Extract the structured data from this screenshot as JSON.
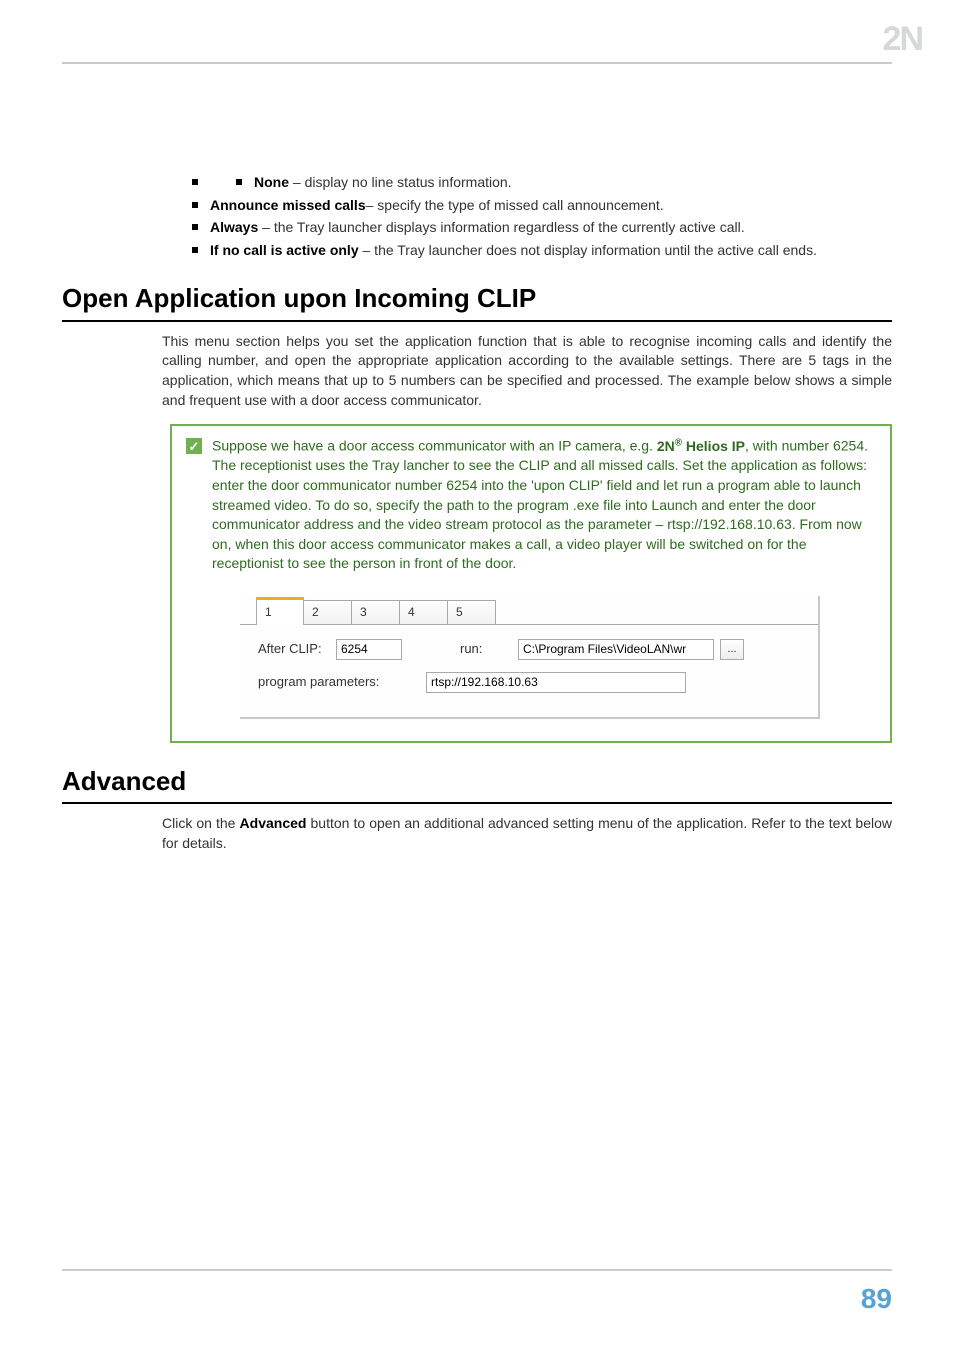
{
  "logo": "2N",
  "bullets": {
    "none": {
      "term": "None",
      "desc": " – display no line status information."
    },
    "announce": {
      "term": "Announce missed calls",
      "desc": "– specify the type of missed call announcement."
    },
    "always": {
      "term": "Always",
      "desc": " – the Tray launcher displays information regardless of the currently active call."
    },
    "ifno": {
      "term": "If no call is active only",
      "desc": " – the Tray launcher does not display information until the active call ends."
    }
  },
  "s1": {
    "heading": "Open Application upon Incoming CLIP",
    "para": "This menu section helps you set the application function that is able to recognise incoming calls and identify the calling number, and open the appropriate application according to the available settings. There are 5 tags in the application, which means that up to 5 numbers can be specified and processed. The example below shows a simple and frequent use with a door access communicator."
  },
  "note": {
    "lead": "Suppose we have a door access communicator with an IP camera, e.g. ",
    "brand": "2N",
    "reg": "®",
    "brand2": " Helios IP",
    "rest": ", with number 6254. The receptionist uses the Tray lancher to see the CLIP and all missed calls. Set the application as follows: enter the door communicator number 6254 into the 'upon CLIP' field and let run a program able to launch streamed video. To do so, specify the path to the program .exe file into Launch and enter the door communicator address and the video stream protocol as the parameter – rtsp://192.168.10.63. From now on, when this door access communicator makes a call, a video player will be switched on for the receptionist to see the person in front of the door."
  },
  "panel": {
    "tabs": [
      "1",
      "2",
      "3",
      "4",
      "5"
    ],
    "after_clip_label": "After CLIP:",
    "after_clip_value": "6254",
    "run_label": "run:",
    "run_value": "C:\\Program Files\\VideoLAN\\wr",
    "browse": "...",
    "params_label": "program parameters:",
    "params_value": "rtsp://192.168.10.63"
  },
  "s2": {
    "heading": "Advanced",
    "p_pre": "Click on the ",
    "p_bold": "Advanced",
    "p_post": " button to open an additional advanced setting menu of the application. Refer to the text below for details."
  },
  "page_number": "89"
}
